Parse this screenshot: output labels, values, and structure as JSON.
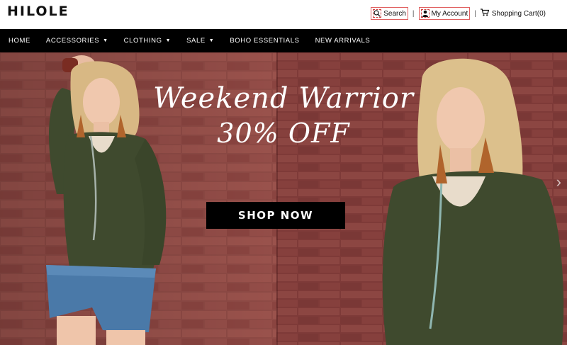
{
  "header": {
    "logo": "HILOLE",
    "search_label": "Search",
    "account_label": "My Account",
    "cart_label": "Shopping Cart(0)",
    "separator": "|"
  },
  "nav": {
    "items": [
      {
        "label": "HOME",
        "has_dropdown": false
      },
      {
        "label": "ACCESSORIES",
        "has_dropdown": true
      },
      {
        "label": "CLOTHING",
        "has_dropdown": true
      },
      {
        "label": "SALE",
        "has_dropdown": true
      },
      {
        "label": "BOHO ESSENTIALS",
        "has_dropdown": false
      },
      {
        "label": "NEW ARRIVALS",
        "has_dropdown": false
      }
    ],
    "caret": "▼"
  },
  "hero": {
    "headline_line1": "Weekend Warrior",
    "headline_line2": "30% OFF",
    "cta_label": "SHOP NOW",
    "next_arrow": "›"
  },
  "icons": {
    "search": "search-icon",
    "account": "user-icon",
    "cart": "cart-icon"
  },
  "colors": {
    "nav_bg": "#000000",
    "brick": "#8b4a45",
    "cta_bg": "#000000",
    "top_highlight_border": "#e06060"
  }
}
